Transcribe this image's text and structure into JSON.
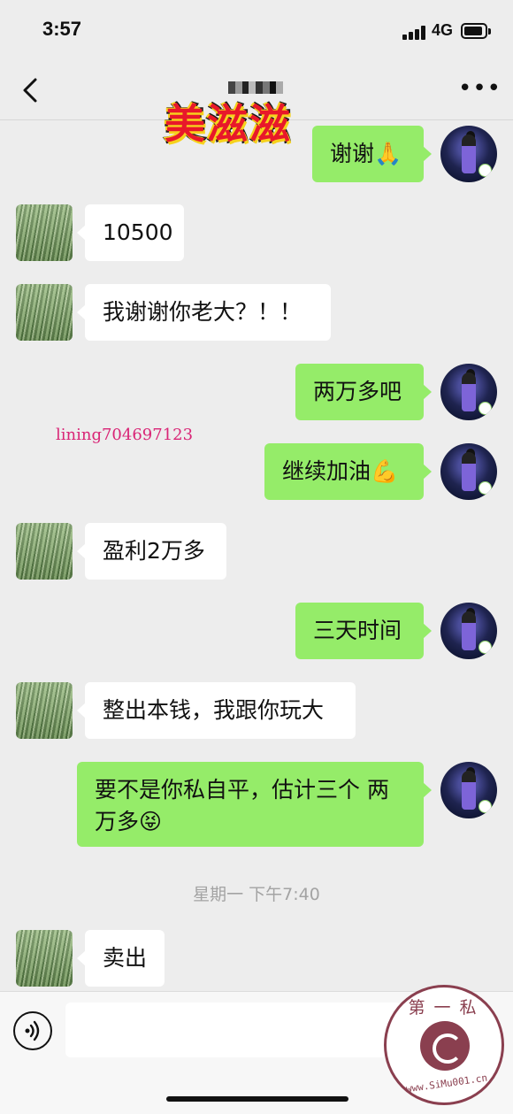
{
  "status_bar": {
    "time": "3:57",
    "network": "4G",
    "battery_level": 0.9
  },
  "nav": {
    "back_icon": "chevron-left-icon",
    "more_label": "•••"
  },
  "overlays": {
    "brand_text": "美滋滋",
    "contact_text": "lining704697123"
  },
  "messages": [
    {
      "side": "out",
      "text": "谢谢🙏"
    },
    {
      "side": "in",
      "text": "10500"
    },
    {
      "side": "in",
      "text": "我谢谢你老大？！！"
    },
    {
      "side": "out",
      "text": "两万多吧"
    },
    {
      "side": "out",
      "text": "继续加油💪"
    },
    {
      "side": "in",
      "text": "盈利2万多"
    },
    {
      "side": "out",
      "text": "三天时间"
    },
    {
      "side": "in",
      "text": "整出本钱，我跟你玩大"
    },
    {
      "side": "out",
      "text": "要不是你私自平，估计三个 两万多😝"
    },
    {
      "side": "in",
      "text": "卖出"
    }
  ],
  "time_separator": "星期一 下午7:40",
  "input_bar": {
    "placeholder": ""
  },
  "stamp": {
    "top": "第一私募",
    "bottom": "www.SiMu001.cn"
  },
  "colors": {
    "background": "#ededed",
    "outgoing_bubble": "#95ec69",
    "incoming_bubble": "#ffffff"
  }
}
